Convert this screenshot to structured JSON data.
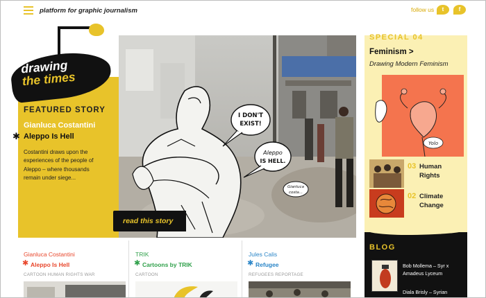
{
  "header": {
    "tagline": "platform for graphic journalism",
    "follow_label": "follow us",
    "social": [
      {
        "icon": "twitter-icon",
        "glyph": "t"
      },
      {
        "icon": "facebook-icon",
        "glyph": "f"
      }
    ]
  },
  "logo": {
    "line1": "drawing",
    "line2": "the times"
  },
  "featured": {
    "label": "FEATURED STORY",
    "author": "Gianluca Costantini",
    "title": "Aleppo Is Hell",
    "description": "Costantini draws upon the experiences of the people of Aleppo – where thousands remain under siege...",
    "cta": "read this story"
  },
  "hero": {
    "bubble1": "I DON'T EXIST!",
    "bubble2": "Aleppo IS HELL.",
    "signature": "Gianluca costa..."
  },
  "special": {
    "heading": "SPECIAL 04",
    "title": "Feminism",
    "arrow": ">",
    "subtitle": "Drawing Modern Feminism",
    "image_text": "Yolo",
    "items": [
      {
        "num": "03",
        "label": "Human Rights"
      },
      {
        "num": "02",
        "label": "Climate Change"
      }
    ]
  },
  "blog": {
    "heading": "BLOG",
    "posts": [
      {
        "text": "Bob Mollema – Syr x Amadeus Lyceum"
      },
      {
        "text": "Diala Brisly – Syrian"
      }
    ]
  },
  "cards": [
    {
      "author": "Gianluca Costantini",
      "title": "Aleppo Is Hell",
      "tags": "CARTOON HUMAN RIGHTS WAR",
      "color": "#e8462b"
    },
    {
      "author": "TRIK",
      "title": "Cartoons by TRIK",
      "tags": "CARTOON",
      "color": "#2fa04a"
    },
    {
      "author": "Jules Calis",
      "title": "Refugee",
      "tags": "REFUGEES REPORTAGE",
      "color": "#2b86c8"
    }
  ],
  "colors": {
    "accent": "#e8c32a",
    "special_bg": "#fbf0b4",
    "dark": "#111111"
  }
}
